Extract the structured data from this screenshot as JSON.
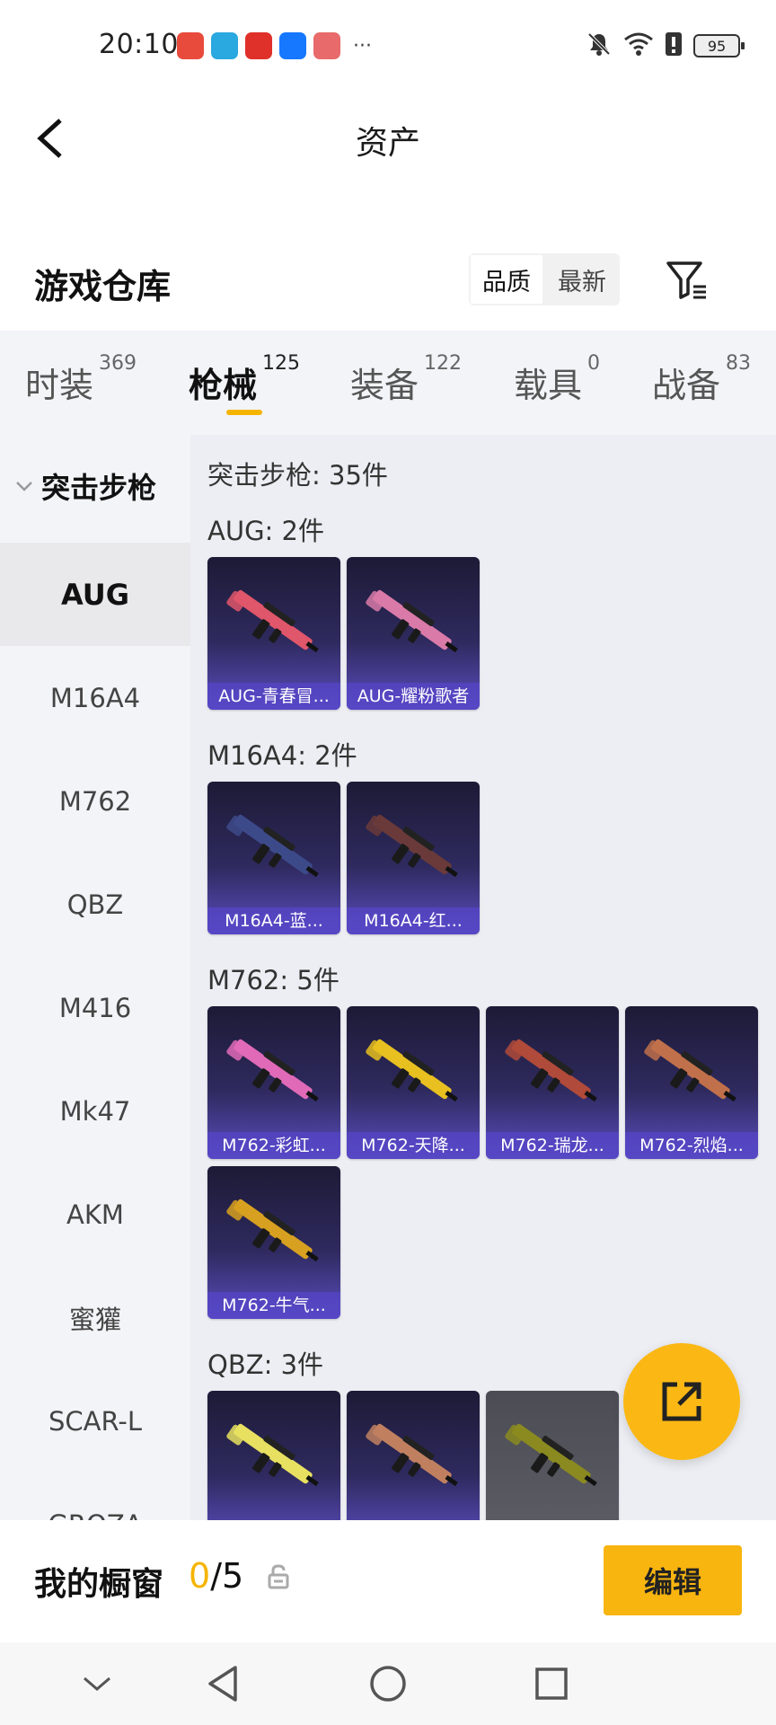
{
  "status": {
    "time": "20:10",
    "more": "···",
    "battery": "95",
    "apps": [
      {
        "icon": "huawei-store-icon",
        "color": "#e84b3c"
      },
      {
        "icon": "cloud-app-icon",
        "color": "#2aa8e0"
      },
      {
        "icon": "red-heart-app-icon",
        "color": "#e0302a"
      },
      {
        "icon": "alipay-icon",
        "color": "#1677ff"
      },
      {
        "icon": "gift-box-icon",
        "color": "#e86a6a"
      }
    ]
  },
  "header": {
    "title": "资产"
  },
  "warehouse": {
    "title": "游戏仓库",
    "sort_options": [
      "品质",
      "最新"
    ],
    "sort_active": 0
  },
  "tabs": [
    {
      "label": "时装",
      "count": "369"
    },
    {
      "label": "枪械",
      "count": "125"
    },
    {
      "label": "装备",
      "count": "122"
    },
    {
      "label": "载具",
      "count": "0"
    },
    {
      "label": "战备",
      "count": "83"
    }
  ],
  "active_tab": 1,
  "sidebar": {
    "group": "突击步枪",
    "items": [
      "AUG",
      "M16A4",
      "M762",
      "QBZ",
      "M416",
      "Mk47",
      "AKM",
      "蜜獾",
      "SCAR-L",
      "GROZA"
    ],
    "active": 0
  },
  "content": {
    "total": "突击步枪: 35件",
    "sections": [
      {
        "title": "AUG: 2件",
        "items": [
          {
            "name": "AUG-青春冒...",
            "color": "#e0566a"
          },
          {
            "name": "AUG-耀粉歌者",
            "color": "#d97aa8"
          }
        ]
      },
      {
        "title": "M16A4: 2件",
        "items": [
          {
            "name": "M16A4-蓝...",
            "color": "#3d4a8a"
          },
          {
            "name": "M16A4-红...",
            "color": "#6a3a3a"
          }
        ]
      },
      {
        "title": "M762: 5件",
        "items": [
          {
            "name": "M762-彩虹...",
            "color": "#e06ab8"
          },
          {
            "name": "M762-天降...",
            "color": "#e8c020"
          },
          {
            "name": "M762-瑞龙...",
            "color": "#b04a3a"
          },
          {
            "name": "M762-烈焰...",
            "color": "#c0704a"
          },
          {
            "name": "M762-牛气...",
            "color": "#d8a020"
          }
        ]
      },
      {
        "title": "QBZ: 3件",
        "items": [
          {
            "name": "",
            "color": "#e8e060"
          },
          {
            "name": "",
            "color": "#c08060"
          },
          {
            "name": "",
            "color": "#8a8a20",
            "grey": true
          }
        ]
      }
    ]
  },
  "bottom": {
    "title": "我的橱窗",
    "current": "0",
    "total": "/5",
    "edit_label": "编辑"
  }
}
